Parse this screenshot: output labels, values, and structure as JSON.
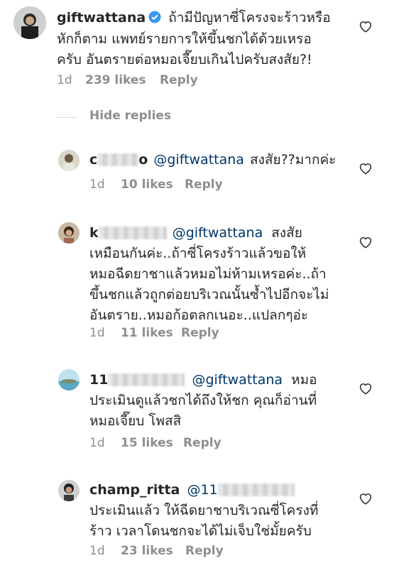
{
  "parent": {
    "username": "giftwattana",
    "lines": [
      "ถ้ามีปัญหาซี่โครงจะร้าวหรือ",
      "หักก็ตาม แพทย์รายการให้ขึ้นชกได้ด้วยเหรอ",
      "ครับ อันตรายต่อหมอเจี๊ยบเกินไปครับสงสัย?!"
    ],
    "time": "1d",
    "likes": "239 likes",
    "reply": "Reply"
  },
  "hide_replies": "Hide replies",
  "replies": [
    {
      "username_visible": "c",
      "username_tail": "o",
      "mention": "@giftwattana",
      "lines": [
        "สงสัย??มากค่ะ"
      ],
      "time": "1d",
      "likes": "10 likes",
      "reply": "Reply"
    },
    {
      "username_visible": "k",
      "mention": "@giftwattana",
      "lines": [
        "สงสัย",
        "เหมือนกันค่ะ..ถ้าซี่โครงร้าวแล้วขอให้",
        "หมอฉีดยาชาแล้วหมอไม่ห้ามเหรอค่ะ..ถ้า",
        "ขึ้นชกแล้วถูกต่อยบริเวณนั้นซ้ำไปอีกจะไม่",
        "อันตราย..หมอก้อตลกเนอะ..แปลกๆอ่ะ"
      ],
      "time": "1d",
      "likes": "11 likes",
      "reply": "Reply"
    },
    {
      "username_visible": "11",
      "mention": "@giftwattana",
      "lines": [
        "หมอ",
        "ประเมินดูแล้วชกได้ถึงให้ชก คุณก็อ่านที่",
        "หมอเจี๊ยบ โพสสิ"
      ],
      "time": "1d",
      "likes": "15 likes",
      "reply": "Reply"
    },
    {
      "username": "champ_ritta",
      "mention": "@11",
      "lines": [
        "ประเมินแล้ว ให้ฉีดยาชาบริเวณซี่โครงที่",
        "ร้าว เวลาโดนชกจะได้ไม่เจ็บใช่มั้ยครับ"
      ],
      "time": "1d",
      "likes": "23 likes",
      "reply": "Reply"
    }
  ]
}
